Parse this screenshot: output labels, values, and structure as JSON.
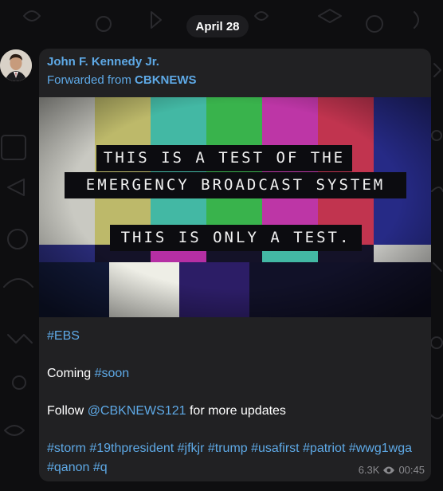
{
  "date_label": "April 28",
  "message": {
    "sender": "John F. Kennedy Jr.",
    "forwarded_prefix": "Forwarded from",
    "forwarded_source": "CBKNEWS",
    "media": {
      "line1": "THIS IS A TEST OF THE",
      "line2": "EMERGENCY BROADCAST SYSTEM",
      "line3": "THIS IS ONLY A TEST."
    },
    "lines": {
      "l1_tag": "#EBS",
      "l2_text": "Coming ",
      "l2_tag": "#soon",
      "l3_pre": "Follow ",
      "l3_mention": "@CBKNEWS121",
      "l3_post": " for more updates",
      "l4_tags": "#storm #19thpresident #jfkjr #trump #usafirst #patriot #wwg1wga",
      "l5_tags": "#qanon #q"
    },
    "views": "6.3K",
    "time": "00:45"
  },
  "colors": {
    "link": "#5ea9e6",
    "bubble": "#212123",
    "background": "#0e0e10"
  },
  "icons": {
    "views": "eye-icon"
  }
}
